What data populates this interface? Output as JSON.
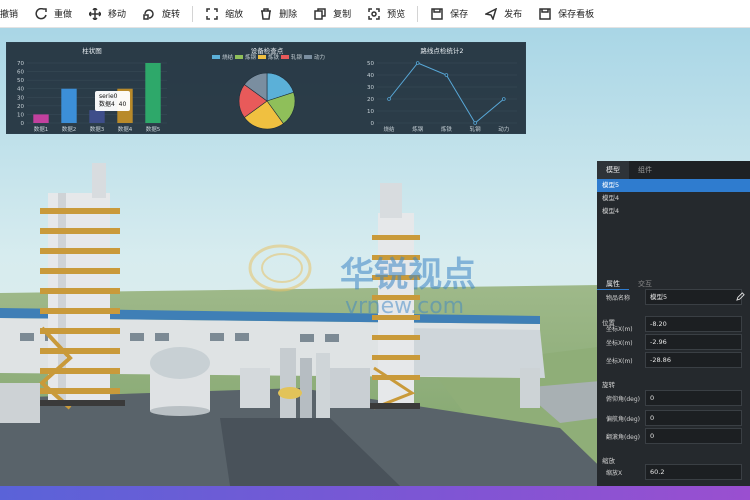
{
  "toolbar": {
    "items": [
      {
        "label": "撤销",
        "icon": "undo-icon"
      },
      {
        "label": "重做",
        "icon": "redo-icon"
      },
      {
        "label": "移动",
        "icon": "move-icon"
      },
      {
        "label": "旋转",
        "icon": "rotate-icon"
      },
      {
        "label": "缩放",
        "icon": "scale-icon"
      },
      {
        "label": "删除",
        "icon": "trash-icon"
      },
      {
        "label": "复制",
        "icon": "copy-icon"
      },
      {
        "label": "预览",
        "icon": "preview-icon"
      },
      {
        "label": "保存",
        "icon": "save-icon"
      },
      {
        "label": "发布",
        "icon": "publish-icon"
      },
      {
        "label": "保存看板",
        "icon": "save-board-icon"
      }
    ]
  },
  "watermark": {
    "cn": "华锐视点",
    "en": "vrnew.com"
  },
  "chart_data": [
    {
      "type": "bar",
      "title": "柱状图",
      "categories": [
        "数据1",
        "数据2",
        "数据3",
        "数据4",
        "数据5"
      ],
      "values": [
        10,
        40,
        15,
        40,
        70
      ],
      "colors": [
        "#c2409e",
        "#3c8fd8",
        "#3e4e8a",
        "#b88a2a",
        "#2ea86a"
      ],
      "ylim": [
        0,
        70
      ],
      "yticks": [
        "0",
        "10",
        "20",
        "30",
        "40",
        "50",
        "60",
        "70"
      ],
      "tooltip": {
        "series": "serie0",
        "label": "数据4",
        "value": "40"
      }
    },
    {
      "type": "pie",
      "title": "设备检查点",
      "legend": [
        "烧结",
        "炼钢",
        "炼铁",
        "轧钢",
        "动力"
      ],
      "values": [
        20,
        20,
        25,
        20,
        15
      ],
      "colors": [
        "#5bb0d8",
        "#8fbf5a",
        "#f0c040",
        "#e85a5a",
        "#7a8ea0"
      ]
    },
    {
      "type": "line",
      "title": "路线点检统计2",
      "categories": [
        "烧结",
        "炼钢",
        "炼铁",
        "轧钢",
        "动力"
      ],
      "values": [
        20,
        50,
        40,
        0,
        20
      ],
      "ylim": [
        0,
        50
      ],
      "yticks": [
        "0",
        "10",
        "20",
        "30",
        "40",
        "50"
      ],
      "color": "#58a8d8"
    }
  ],
  "panel": {
    "tabs": [
      "模型",
      "组件"
    ],
    "models": [
      "模型5",
      "模型4",
      "模型4"
    ],
    "prop_tabs": [
      "属性",
      "交互"
    ],
    "fields": {
      "name_label": "物品名称",
      "name_value": "模型5",
      "position_title": "位置",
      "pos_x_label": "坐标X(m)",
      "pos_x_value": "-8.20",
      "pos_y_label": "坐标X(m)",
      "pos_y_value": "-2.96",
      "pos_z_label": "坐标X(m)",
      "pos_z_value": "-28.86",
      "rotation_title": "旋转",
      "pitch_label": "俯仰角(deg)",
      "pitch_value": "0",
      "yaw_label": "偏航角(deg)",
      "yaw_value": "0",
      "roll_label": "翻滚角(deg)",
      "roll_value": "0",
      "scale_title": "缩放",
      "scale_x_label": "缩放X",
      "scale_x_value": "60.2"
    }
  },
  "colors": {
    "accent": "#2f7ccf",
    "panel_bg": "#25292d",
    "chart_bg": "#1e2e3a"
  }
}
